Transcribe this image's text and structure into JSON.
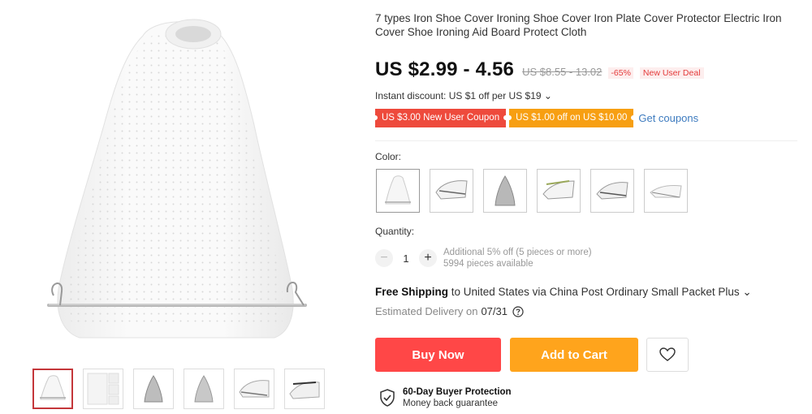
{
  "product": {
    "title": "7 types Iron Shoe Cover Ironing Shoe Cover Iron Plate Cover Protector Electric Iron Cover Shoe Ironing Aid Board Protect Cloth",
    "price": "US $2.99 - 4.56",
    "old_price": "US $8.55 - 13.02",
    "discount": "-65%",
    "deal_badge": "New User Deal"
  },
  "discounts": {
    "instant": "Instant discount: US $1 off per US $19 ⌄",
    "coupon_new_user": "US $3.00 New User Coupon",
    "coupon_off": "US $1.00 off on US $10.00",
    "get_coupons": "Get coupons"
  },
  "color": {
    "label": "Color:",
    "options": [
      "white-cover",
      "cover-side-1",
      "silver-plate",
      "cover-side-2",
      "cover-side-3",
      "cover-side-4"
    ],
    "selected_index": 0
  },
  "quantity": {
    "label": "Quantity:",
    "value": "1",
    "minus": "−",
    "plus": "+",
    "info_line1": "Additional 5% off (5 pieces or more)",
    "info_line2": "5994 pieces available"
  },
  "shipping": {
    "free": "Free Shipping",
    "details": " to United States via China Post Ordinary Small Packet Plus ⌄",
    "estimated_label": "Estimated Delivery on",
    "estimated_date": "07/31"
  },
  "actions": {
    "buy_now": "Buy Now",
    "add_to_cart": "Add to Cart"
  },
  "protection": {
    "title": "60-Day Buyer Protection",
    "subtitle": "Money back guarantee"
  },
  "colors": {
    "buy": "#ff4747",
    "cart": "#ffa41c",
    "coupon_red": "#ee4a3c",
    "coupon_orange": "#f79f12",
    "link": "#3d7bbf",
    "selected_thumb": "#c4363a"
  }
}
